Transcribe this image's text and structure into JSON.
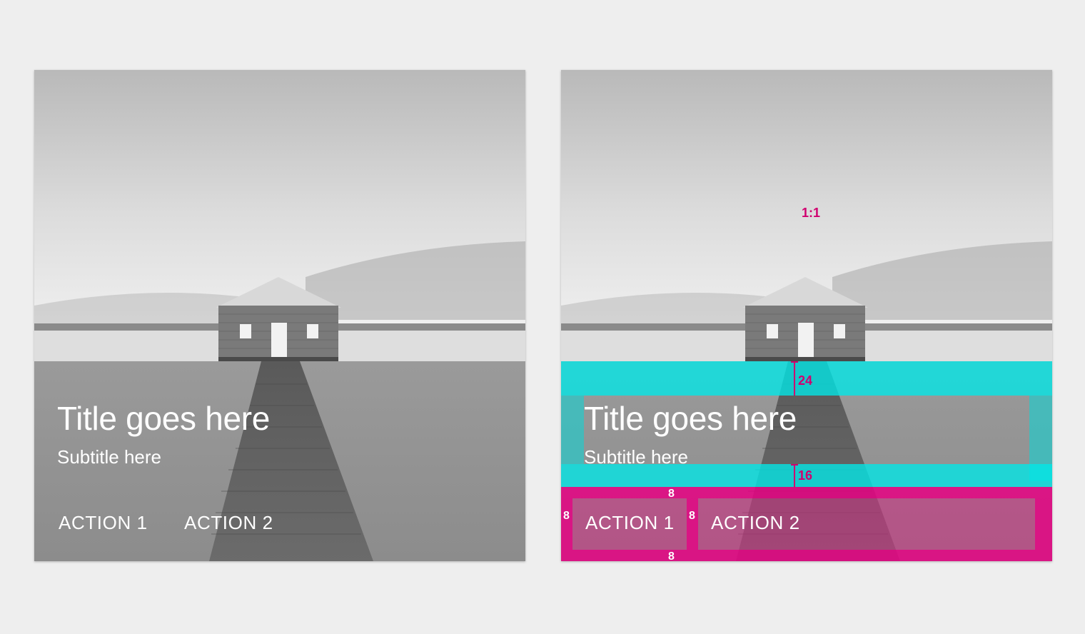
{
  "cards": [
    {
      "title": "Title goes here",
      "subtitle": "Subtitle here",
      "actions": [
        "ACTION 1",
        "ACTION 2"
      ]
    },
    {
      "title": "Title goes here",
      "subtitle": "Subtitle here",
      "actions": [
        "ACTION 1",
        "ACTION 2"
      ],
      "spec": {
        "aspect_ratio": "1:1",
        "title_top_padding": "24",
        "text_bottom_padding": "16",
        "action_padding": "8",
        "action_gap": "8",
        "action_top": "8",
        "action_bottom": "8"
      }
    }
  ],
  "colors": {
    "background": "#eeeeee",
    "overlay_cyan": "#00e8e8",
    "overlay_magenta": "#e60082",
    "spec_text": "#d0006f"
  }
}
